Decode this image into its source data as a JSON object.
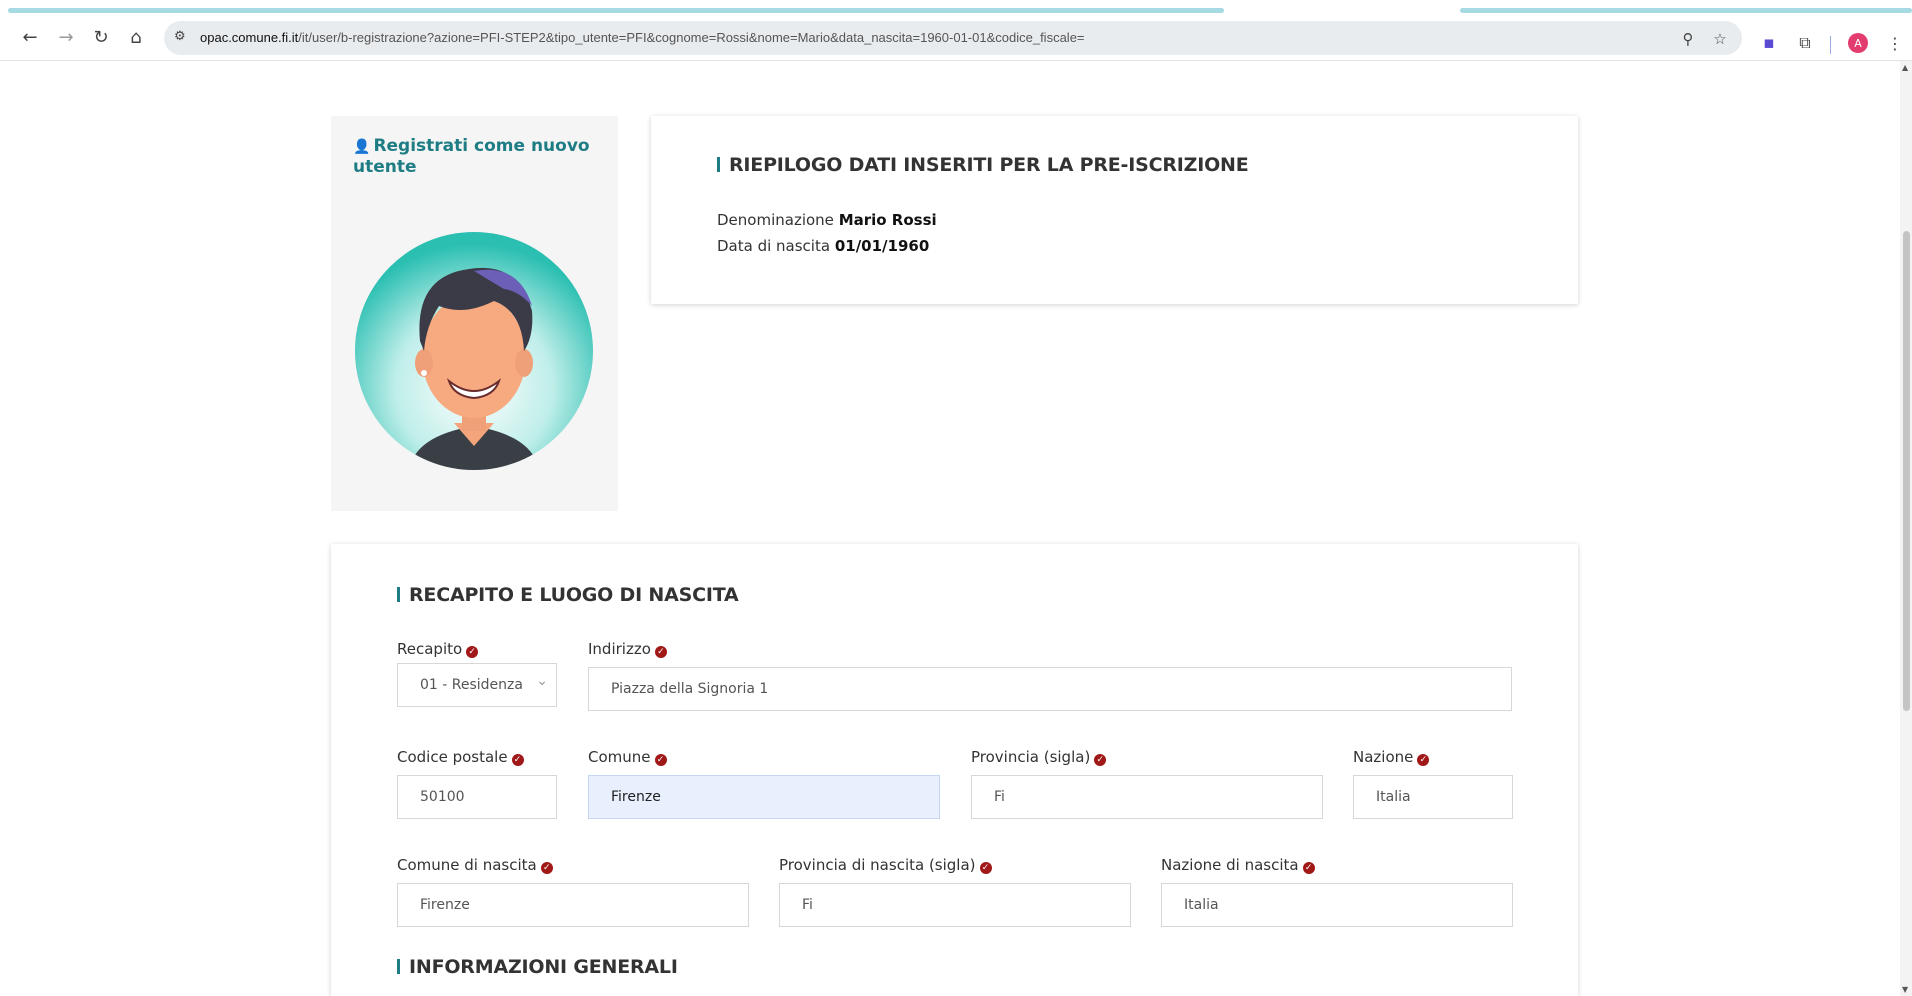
{
  "browser": {
    "url_host": "opac.comune.fi.it",
    "url_path": "/it/user/b-registrazione?azione=PFI-STEP2&tipo_utente=PFI&cognome=Rossi&nome=Mario&data_nascita=1960-01-01&codice_fiscale=",
    "profile_initial": "A"
  },
  "sidebar": {
    "title": "Registrati come nuovo utente"
  },
  "summary": {
    "title": "RIEPILOGO DATI INSERITI PER LA PRE-ISCRIZIONE",
    "denominazione_label": "Denominazione",
    "denominazione_value": "Mario Rossi",
    "data_label": "Data di nascita",
    "data_value": "01/01/1960"
  },
  "form": {
    "section_title": "RECAPITO E LUOGO DI NASCITA",
    "recapito": {
      "label": "Recapito",
      "value": "01 - Residenza"
    },
    "indirizzo": {
      "label": "Indirizzo",
      "value": "Piazza della Signoria 1"
    },
    "cap": {
      "label": "Codice postale",
      "value": "50100"
    },
    "comune": {
      "label": "Comune",
      "value": "Firenze"
    },
    "provincia": {
      "label": "Provincia (sigla)",
      "value": "Fi"
    },
    "nazione": {
      "label": "Nazione",
      "value": "Italia"
    },
    "comune_nascita": {
      "label": "Comune di nascita",
      "value": "Firenze"
    },
    "provincia_nascita": {
      "label": "Provincia di nascita (sigla)",
      "value": "Fi"
    },
    "nazione_nascita": {
      "label": "Nazione di nascita",
      "value": "Italia"
    },
    "next_section_title": "INFORMAZIONI GENERALI"
  }
}
